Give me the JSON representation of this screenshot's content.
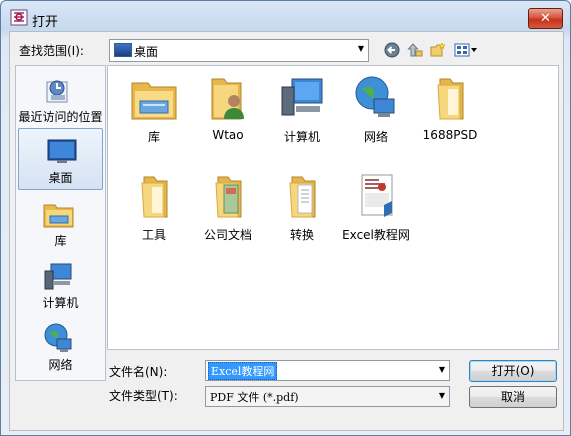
{
  "window": {
    "title": "打开",
    "close_glyph": "✕"
  },
  "lookin": {
    "label": "查找范围(I):",
    "value": "桌面"
  },
  "places": [
    {
      "label": "最近访问的位置",
      "icon": "recent-places-icon"
    },
    {
      "label": "桌面",
      "icon": "desktop-icon",
      "selected": true
    },
    {
      "label": "库",
      "icon": "libraries-icon"
    },
    {
      "label": "计算机",
      "icon": "computer-icon"
    },
    {
      "label": "网络",
      "icon": "network-icon"
    }
  ],
  "items": [
    {
      "label": "库",
      "icon": "libraries-icon"
    },
    {
      "label": "Wtao",
      "icon": "user-folder-icon"
    },
    {
      "label": "计算机",
      "icon": "computer-icon"
    },
    {
      "label": "网络",
      "icon": "network-icon"
    },
    {
      "label": "1688PSD",
      "icon": "folder-icon"
    },
    {
      "label": "工具",
      "icon": "folder-icon"
    },
    {
      "label": "公司文档",
      "icon": "folder-icon"
    },
    {
      "label": "转换",
      "icon": "folder-icon"
    },
    {
      "label": "Excel教程网",
      "icon": "document-icon"
    }
  ],
  "filename": {
    "label": "文件名(N):",
    "value": "Excel教程网"
  },
  "filetype": {
    "label": "文件类型(T):",
    "value": "PDF 文件 (*.pdf)"
  },
  "buttons": {
    "open": "打开(O)",
    "cancel": "取消"
  }
}
